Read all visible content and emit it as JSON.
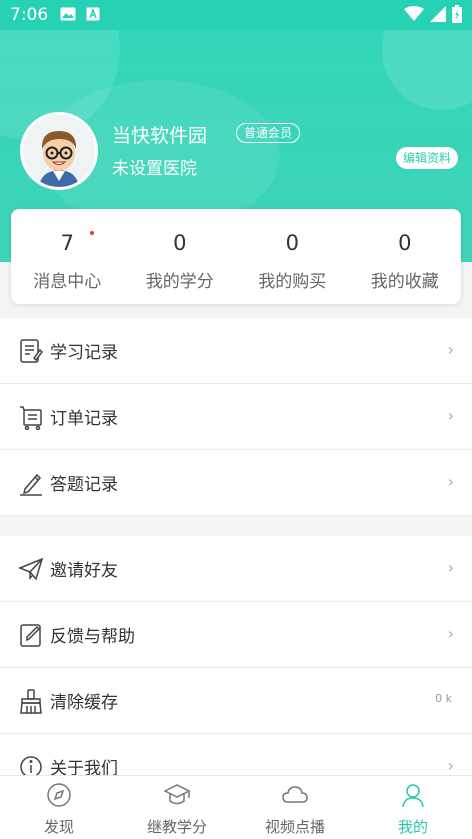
{
  "status_bar": {
    "time": "7:06"
  },
  "profile": {
    "name": "当快软件园",
    "member_badge": "普通会员",
    "hospital": "未设置医院",
    "edit_label": "编辑资料"
  },
  "stats": [
    {
      "value": "7",
      "label": "消息中心",
      "has_dot": true
    },
    {
      "value": "0",
      "label": "我的学分"
    },
    {
      "value": "0",
      "label": "我的购买"
    },
    {
      "value": "0",
      "label": "我的收藏"
    }
  ],
  "menu_group1": [
    {
      "label": "学习记录",
      "icon": "study-record-icon"
    },
    {
      "label": "订单记录",
      "icon": "cart-icon"
    },
    {
      "label": "答题记录",
      "icon": "pencil-icon"
    }
  ],
  "menu_group2": [
    {
      "label": "邀请好友",
      "icon": "paper-plane-icon"
    },
    {
      "label": "反馈与帮助",
      "icon": "feedback-icon"
    },
    {
      "label": "清除缓存",
      "icon": "broom-icon",
      "value": "0 k"
    },
    {
      "label": "关于我们",
      "icon": "info-icon"
    }
  ],
  "bottom_nav": [
    {
      "label": "发现",
      "icon": "compass-icon"
    },
    {
      "label": "继教学分",
      "icon": "graduation-cap-icon"
    },
    {
      "label": "视频点播",
      "icon": "cloud-icon"
    },
    {
      "label": "我的",
      "icon": "person-icon",
      "active": true
    }
  ],
  "colors": {
    "accent": "#26d1b4",
    "active_nav": "#26c8ac",
    "badge_dot": "#e43b3b"
  }
}
